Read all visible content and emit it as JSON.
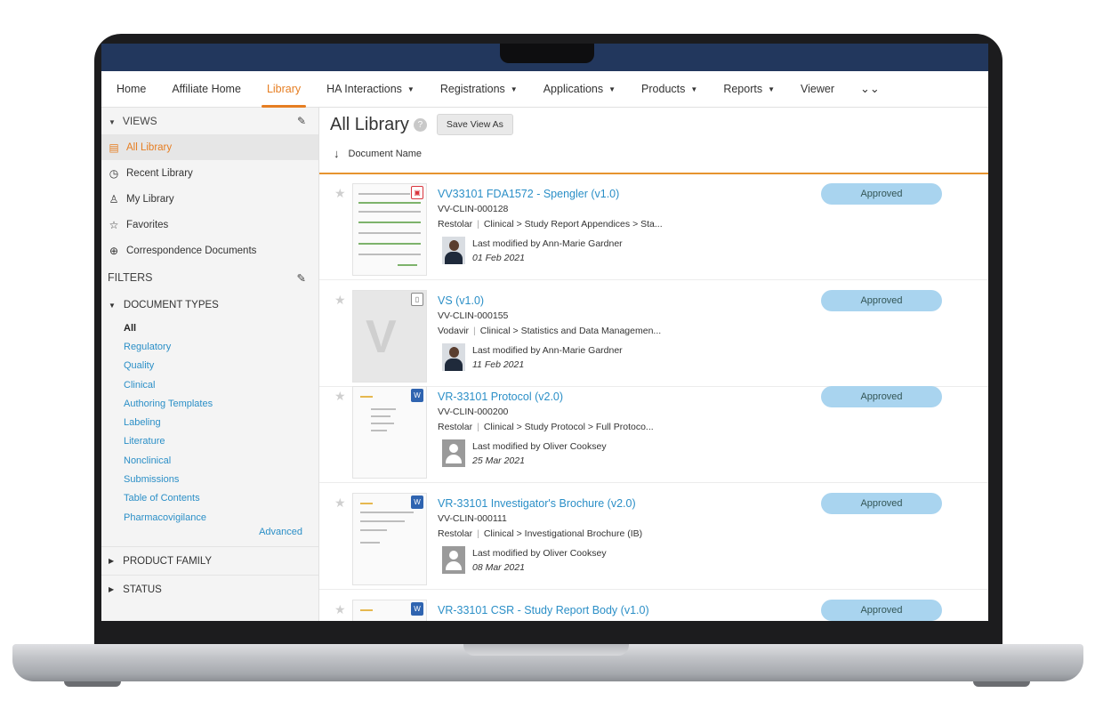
{
  "nav": {
    "items": [
      {
        "label": "Home",
        "dropdown": false,
        "active": false
      },
      {
        "label": "Affiliate Home",
        "dropdown": false,
        "active": false
      },
      {
        "label": "Library",
        "dropdown": false,
        "active": true
      },
      {
        "label": "HA Interactions",
        "dropdown": true,
        "active": false
      },
      {
        "label": "Registrations",
        "dropdown": true,
        "active": false
      },
      {
        "label": "Applications",
        "dropdown": true,
        "active": false
      },
      {
        "label": "Products",
        "dropdown": true,
        "active": false
      },
      {
        "label": "Reports",
        "dropdown": true,
        "active": false
      },
      {
        "label": "Viewer",
        "dropdown": false,
        "active": false
      }
    ],
    "more_icon": "double-chevron-down-icon"
  },
  "sidebar": {
    "views_label": "VIEWS",
    "views": [
      {
        "label": "All Library",
        "icon": "document-icon",
        "active": true
      },
      {
        "label": "Recent Library",
        "icon": "clock-icon",
        "active": false
      },
      {
        "label": "My Library",
        "icon": "user-icon",
        "active": false
      },
      {
        "label": "Favorites",
        "icon": "star-icon",
        "active": false
      },
      {
        "label": "Correspondence Documents",
        "icon": "search-doc-icon",
        "active": false
      }
    ],
    "filters_label": "FILTERS",
    "document_types_label": "DOCUMENT TYPES",
    "document_types": [
      "All",
      "Regulatory",
      "Quality",
      "Clinical",
      "Authoring Templates",
      "Labeling",
      "Literature",
      "Nonclinical",
      "Submissions",
      "Table of Contents",
      "Pharmacovigilance"
    ],
    "advanced_label": "Advanced",
    "product_family_label": "PRODUCT FAMILY",
    "status_label": "STATUS"
  },
  "main": {
    "title": "All Library",
    "save_view_label": "Save View As",
    "sort_label": "Document Name",
    "documents": [
      {
        "title": "VV33101 FDA1572 - Spengler (v1.0)",
        "number": "VV-CLIN-000128",
        "product": "Restolar",
        "path": "Clinical > Study Report Appendices > Sta...",
        "modified": "Last modified by Ann-Marie Gardner",
        "date": "01 Feb 2021",
        "status": "Approved",
        "file_type": "pdf",
        "avatar": "person"
      },
      {
        "title": "VS (v1.0)",
        "number": "VV-CLIN-000155",
        "product": "Vodavir",
        "path": "Clinical > Statistics and Data Managemen...",
        "modified": "Last modified by Ann-Marie Gardner",
        "date": "11 Feb 2021",
        "status": "Approved",
        "file_type": "generic",
        "avatar": "person"
      },
      {
        "title": "VR-33101 Protocol (v2.0)",
        "number": "VV-CLIN-000200",
        "product": "Restolar",
        "path": "Clinical > Study Protocol > Full Protoco...",
        "modified": "Last modified by Oliver Cooksey",
        "date": "25 Mar 2021",
        "status": "Approved",
        "file_type": "word",
        "avatar": "placeholder"
      },
      {
        "title": "VR-33101 Investigator's Brochure (v2.0)",
        "number": "VV-CLIN-000111",
        "product": "Restolar",
        "path": "Clinical > Investigational Brochure (IB)",
        "modified": "Last modified by Oliver Cooksey",
        "date": "08 Mar 2021",
        "status": "Approved",
        "file_type": "word",
        "avatar": "placeholder"
      },
      {
        "title": "VR-33101 CSR - Study Report Body (v1.0)",
        "number": "",
        "product": "",
        "path": "",
        "modified": "",
        "date": "",
        "status": "Approved",
        "file_type": "word",
        "avatar": ""
      }
    ]
  }
}
